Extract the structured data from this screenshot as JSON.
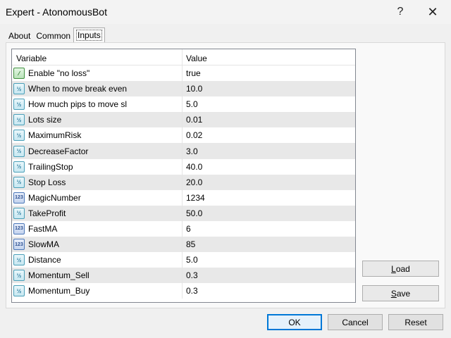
{
  "window": {
    "title": "Expert - AtonomousBot",
    "help_glyph": "?",
    "close_glyph": "✕"
  },
  "tabs": [
    {
      "label": "About"
    },
    {
      "label": "Common"
    },
    {
      "label": "Inputs",
      "active": true
    }
  ],
  "grid": {
    "headers": {
      "variable": "Variable",
      "value": "Value"
    },
    "rows": [
      {
        "variable": "Enable \"no loss\"",
        "value": "true",
        "icon": "bool-icon",
        "glyph": "⁄"
      },
      {
        "variable": "When to move break even",
        "value": "10.0",
        "icon": "double-icon",
        "glyph": "½"
      },
      {
        "variable": "How much pips to move sl",
        "value": "5.0",
        "icon": "double-icon",
        "glyph": "½"
      },
      {
        "variable": "Lots size",
        "value": "0.01",
        "icon": "double-icon",
        "glyph": "½"
      },
      {
        "variable": "MaximumRisk",
        "value": "0.02",
        "icon": "double-icon",
        "glyph": "½"
      },
      {
        "variable": "DecreaseFactor",
        "value": "3.0",
        "icon": "double-icon",
        "glyph": "½"
      },
      {
        "variable": "TrailingStop",
        "value": "40.0",
        "icon": "double-icon",
        "glyph": "½"
      },
      {
        "variable": "Stop Loss",
        "value": "20.0",
        "icon": "double-icon",
        "glyph": "½"
      },
      {
        "variable": "MagicNumber",
        "value": "1234",
        "icon": "integer-icon",
        "glyph": "123"
      },
      {
        "variable": "TakeProfit",
        "value": "50.0",
        "icon": "double-icon",
        "glyph": "½"
      },
      {
        "variable": "FastMA",
        "value": "6",
        "icon": "integer-icon",
        "glyph": "123"
      },
      {
        "variable": "SlowMA",
        "value": "85",
        "icon": "integer-icon",
        "glyph": "123"
      },
      {
        "variable": "Distance",
        "value": "5.0",
        "icon": "double-icon",
        "glyph": "½"
      },
      {
        "variable": "Momentum_Sell",
        "value": "0.3",
        "icon": "double-icon",
        "glyph": "½"
      },
      {
        "variable": "Momentum_Buy",
        "value": "0.3",
        "icon": "double-icon",
        "glyph": "½"
      }
    ]
  },
  "side_buttons": {
    "load": {
      "label": "Load",
      "accel": "L",
      "rest": "oad"
    },
    "save": {
      "label": "Save",
      "accel": "S",
      "rest": "ave"
    }
  },
  "footer": {
    "ok": "OK",
    "cancel": "Cancel",
    "reset": "Reset"
  }
}
